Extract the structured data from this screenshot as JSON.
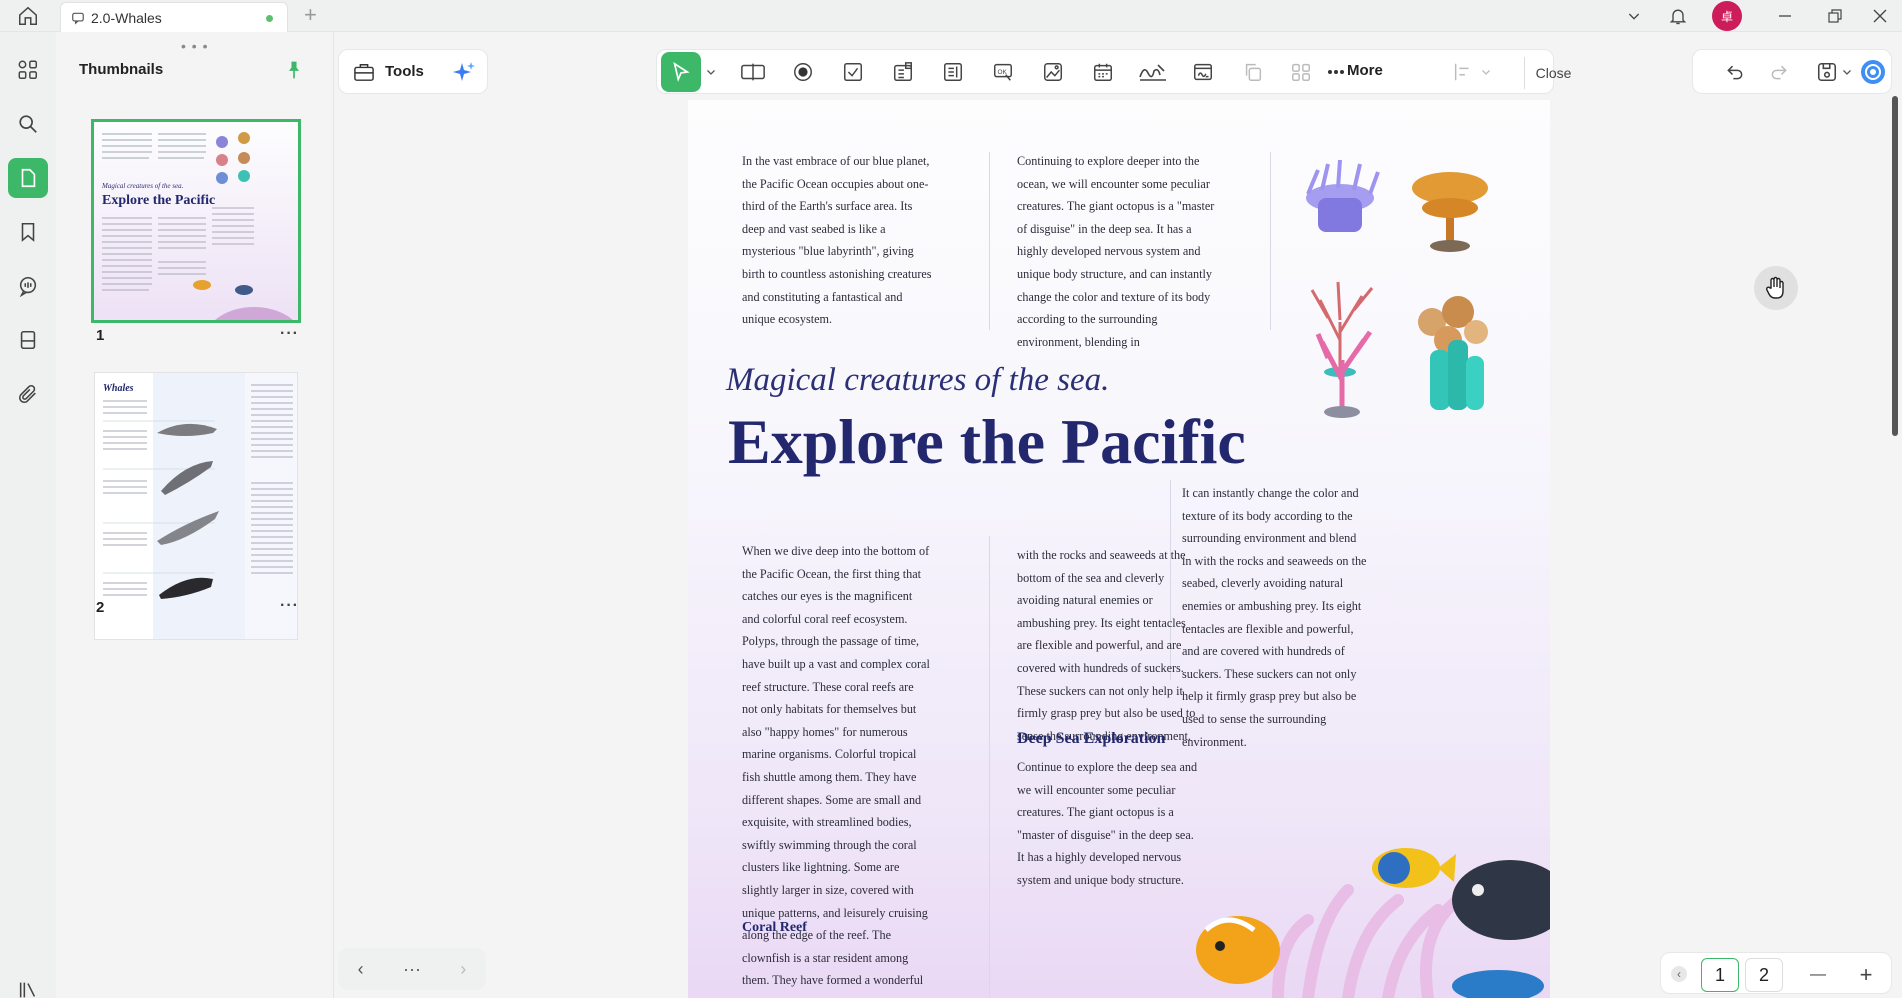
{
  "tab": {
    "title": "2.0-Whales",
    "add": "+"
  },
  "user": {
    "initial": "卓"
  },
  "panel": {
    "title": "Thumbnails",
    "grip": "• • •",
    "pages": [
      {
        "label": "1",
        "more": "···"
      },
      {
        "label": "2",
        "more": "···"
      }
    ],
    "nav": {
      "prev": "‹",
      "mid": "···",
      "next": "›"
    }
  },
  "toolbar": {
    "tools_label": "Tools",
    "more_label": "More",
    "close_label": "Close"
  },
  "document": {
    "intro": "In the vast embrace of our blue planet, the Pacific Ocean occupies about one-third of the Earth's surface area. Its deep and vast seabed is like a mysterious \"blue labyrinth\", giving birth to countless astonishing creatures and constituting a fantastical and unique ecosystem.",
    "col2_top": "Continuing to explore deeper into the ocean, we will encounter some peculiar creatures. The giant octopus is a \"master of disguise\" in the deep sea. It has a highly developed nervous system and unique body structure, and can instantly change the color and texture of its body according to the surrounding environment, blending in",
    "subtitle": "Magical creatures of the sea.",
    "title": "Explore the Pacific",
    "right_col": "It can instantly change the color and texture of its body according to the surrounding environment and blend in with the rocks and seaweeds on the seabed, cleverly avoiding natural enemies or ambushing prey. Its eight tentacles are flexible and powerful, and are covered with hundreds of suckers. These suckers can not only help it firmly grasp prey but also be used to sense the surrounding environment.",
    "left_body": "When we dive deep into the bottom of the Pacific Ocean, the first thing that catches our eyes is the magnificent and colorful coral reef ecosystem. Polyps, through the passage of time, have built up a vast and complex coral reef structure. These coral reefs are not only habitats for themselves but also \"happy homes\" for numerous marine organisms. Colorful tropical fish shuttle among them. They have different shapes. Some are small and exquisite, with streamlined bodies, swiftly swimming through the coral clusters like lightning. Some are slightly larger in size, covered with unique patterns, and leisurely cruising along the edge of the reef. The clownfish is a star resident among them. They have formed a wonderful symbiotic relationship with sea anemones.",
    "mid_body": "with the rocks and seaweeds at the bottom of the sea and cleverly avoiding natural enemies or ambushing prey. Its eight tentacles are flexible and powerful, and are covered with hundreds of suckers. These suckers can not only help it firmly grasp prey but also be used to sense the surrounding environment.",
    "deep_heading": "Deep Sea Exploration",
    "deep_body": "Continue to explore the deep sea and we will encounter some peculiar creatures. The giant octopus is a \"master of disguise\" in the deep sea. It has a highly developed nervous system and unique body structure.",
    "coral_heading": "Coral Reef"
  },
  "thumb2": {
    "title": "Whales"
  },
  "pagination": {
    "prev": "‹",
    "pages": [
      "1",
      "2"
    ],
    "zoom_out": "—",
    "zoom_in": "+"
  },
  "colors": {
    "accent": "#3cb868",
    "title": "#23286e",
    "avatar": "#cc1c5a"
  }
}
